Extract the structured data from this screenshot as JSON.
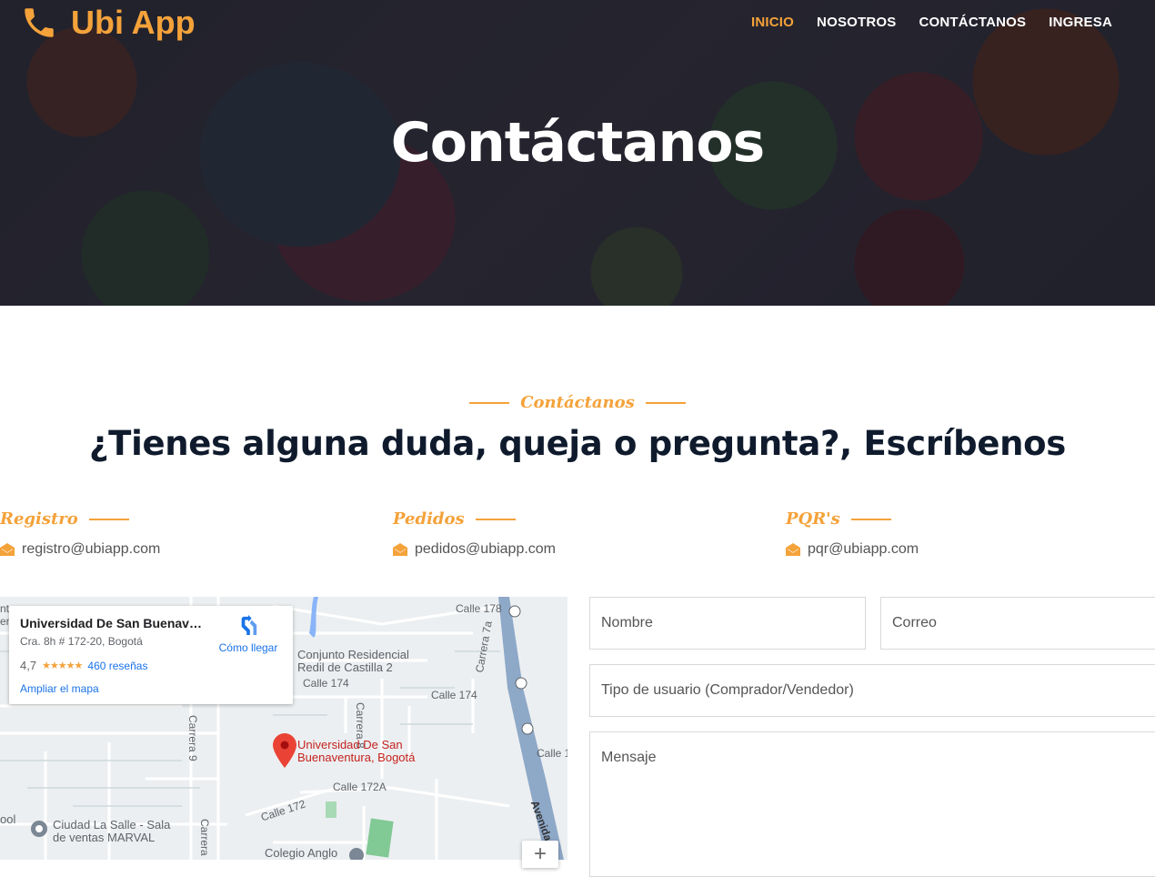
{
  "brand": {
    "name": "Ubi App",
    "accent": "#f4a23a"
  },
  "nav": {
    "items": [
      "INICIO",
      "NOSOTROS",
      "CONTÁCTANOS",
      "INGRESA"
    ],
    "active": "INICIO"
  },
  "hero": {
    "title": "Contáctanos"
  },
  "section": {
    "label": "Contáctanos",
    "heading": "¿Tienes alguna duda, queja o pregunta?, Escríbenos"
  },
  "contacts": [
    {
      "title": "Registro",
      "email": "registro@ubiapp.com"
    },
    {
      "title": "Pedidos",
      "email": "pedidos@ubiapp.com"
    },
    {
      "title": "PQR's",
      "email": "pqr@ubiapp.com"
    }
  ],
  "map": {
    "place_name": "Universidad De San Buenaven...",
    "address": "Cra. 8h # 172-20, Bogotá",
    "rating": "4,7",
    "stars": "★★★★★",
    "reviews": "460 reseñas",
    "enlarge": "Ampliar el mapa",
    "directions": "Cómo llegar",
    "labels": {
      "calle178": "Calle 178",
      "conjunto": "Conjunto Residencial",
      "conjunto2": "Redil de Castilla 2",
      "calle174a": "Calle 174",
      "calle174b": "Calle 174",
      "carrera8": "Carrera 8",
      "carrera7a": "Carrera 7a",
      "carrera9": "Carrera 9",
      "poi1": "Universidad De San",
      "poi2": "Buenaventura, Bogotá",
      "calle172a": "Calle 172A",
      "calle172": "Calle 172",
      "calle1": "Calle 1",
      "avenida": "Avenida",
      "lasalle1": "Ciudad La Salle - Sala",
      "lasalle2": "de ventas MARVAL",
      "anglo": "Colegio Anglo",
      "carrera": "Carrera",
      "edge1": "nto",
      "edge2": "ena",
      "edge3": "ool"
    },
    "zoom": "+"
  },
  "form": {
    "name_placeholder": "Nombre",
    "email_placeholder": "Correo",
    "user_type_placeholder": "Tipo de usuario (Comprador/Vendedor)",
    "message_placeholder": "Mensaje"
  }
}
